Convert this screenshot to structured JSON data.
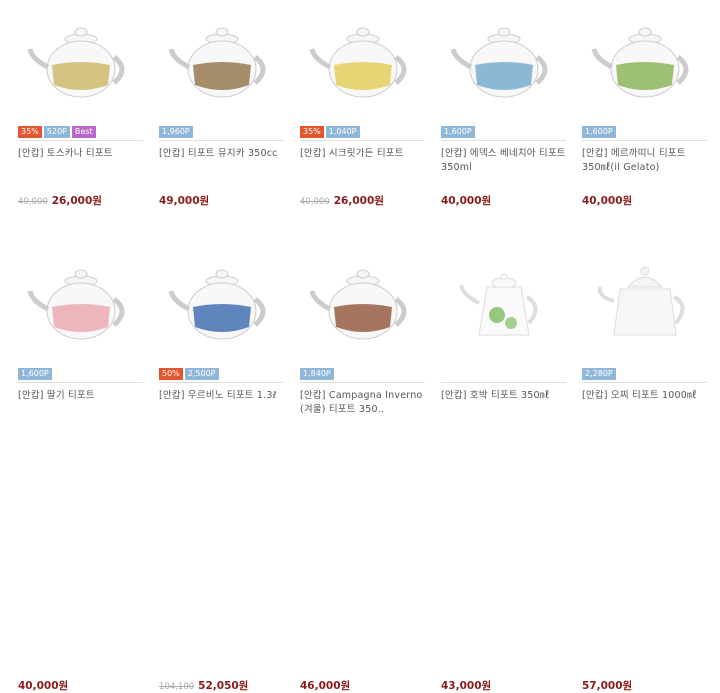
{
  "products": [
    {
      "badges": [
        {
          "type": "sale",
          "text": "35%"
        },
        {
          "type": "pt",
          "text": "520P"
        },
        {
          "type": "best",
          "text": "Best"
        }
      ],
      "name": "[안캅] 토스카나 티포트",
      "old_price": "40,000",
      "price": "26,000원",
      "icon": "teapot-tuscany-icon",
      "accent": "#c9b15a"
    },
    {
      "badges": [
        {
          "type": "pt",
          "text": "1,960P"
        }
      ],
      "name": "[안캅] 티포트 뮤지카 350cc",
      "old_price": "",
      "price": "49,000원",
      "icon": "teapot-musica-icon",
      "accent": "#8a6a3a"
    },
    {
      "badges": [
        {
          "type": "sale",
          "text": "35%"
        },
        {
          "type": "pt",
          "text": "1,040P"
        }
      ],
      "name": "[안캅] 시크릿가든 티포트",
      "old_price": "40,000",
      "price": "26,000원",
      "icon": "teapot-secret-garden-icon",
      "accent": "#e2c84a"
    },
    {
      "badges": [
        {
          "type": "pt",
          "text": "1,600P"
        }
      ],
      "name": "[안캅] 에덱스 베네치아 티포트 350ml",
      "old_price": "",
      "price": "40,000원",
      "icon": "teapot-venezia-icon",
      "accent": "#6aa3c9"
    },
    {
      "badges": [
        {
          "type": "pt",
          "text": "1,600P"
        }
      ],
      "name": "[안캅] 메르까띠니 티포트 350㎖(il Gelato)",
      "old_price": "",
      "price": "40,000원",
      "icon": "teapot-mercatini-icon",
      "accent": "#7fae48"
    },
    {
      "badges": [
        {
          "type": "pt",
          "text": "1,600P"
        }
      ],
      "name": "[안캅] 딸기 티포트",
      "old_price": "",
      "price": "40,000원",
      "icon": "teapot-strawberry-icon",
      "accent": "#e8a0a8"
    },
    {
      "badges": [
        {
          "type": "sale",
          "text": "50%"
        },
        {
          "type": "pt",
          "text": "2,500P"
        }
      ],
      "name": "[안캅] 우르비노 티포트 1.3ℓ",
      "old_price": "104,100",
      "price": "52,050원",
      "icon": "teapot-urbino-icon",
      "accent": "#2e5da8"
    },
    {
      "badges": [
        {
          "type": "pt",
          "text": "1,840P"
        }
      ],
      "name": "[안캅] Campagna Inverno (겨울) 티포트 350..",
      "old_price": "",
      "price": "46,000원",
      "icon": "teapot-campagna-icon",
      "accent": "#8a4a2e"
    },
    {
      "badges": [],
      "name": "[안캅] 호박 티포트 350㎖",
      "old_price": "",
      "price": "43,000원",
      "icon": "teapot-pumpkin-icon",
      "accent": "#6ab04a"
    },
    {
      "badges": [
        {
          "type": "pt",
          "text": "2,280P"
        }
      ],
      "name": "[안캅] 오찌 티포트 1000㎖",
      "old_price": "",
      "price": "57,000원",
      "icon": "teapot-plain-white-icon",
      "accent": "#dcdcdc"
    }
  ]
}
